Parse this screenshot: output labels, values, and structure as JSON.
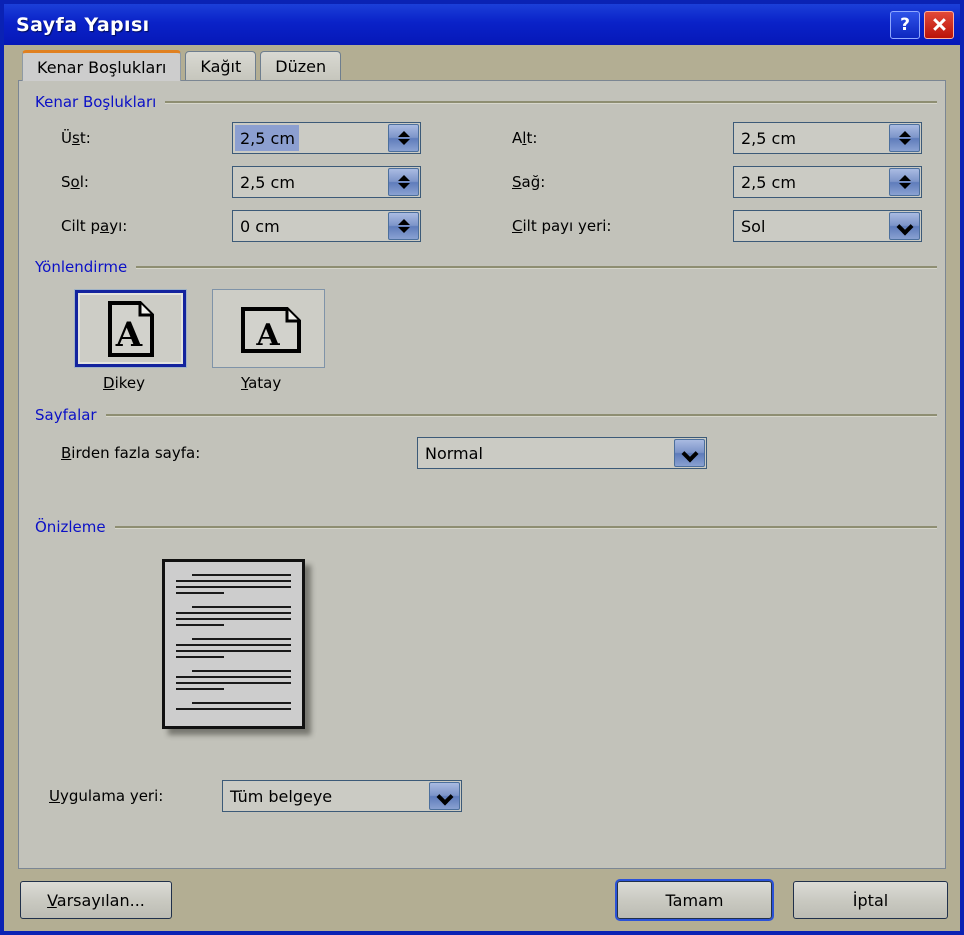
{
  "window": {
    "title": "Sayfa Yapısı",
    "help_button": "?",
    "close_button": "×"
  },
  "tabs": [
    {
      "label": "Kenar Boşlukları",
      "active": true
    },
    {
      "label": "Kağıt",
      "active": false
    },
    {
      "label": "Düzen",
      "active": false
    }
  ],
  "margins_group": {
    "title": "Kenar Boşlukları",
    "fields": {
      "top": {
        "label": "Üst:",
        "accel": "s",
        "value": "2,5 cm",
        "selected": true
      },
      "left": {
        "label": "Sol:",
        "accel": "o",
        "value": "2,5 cm",
        "selected": false
      },
      "gutter": {
        "label": "Cilt payı:",
        "accel": "a",
        "value": "0 cm",
        "selected": false
      },
      "bottom": {
        "label": "Alt:",
        "accel": "l",
        "value": "2,5 cm",
        "selected": false
      },
      "right": {
        "label": "Sağ:",
        "accel": "S",
        "value": "2,5 cm",
        "selected": false
      },
      "gutter_position": {
        "label": "Cilt payı yeri:",
        "accel": "C",
        "value": "Sol"
      }
    }
  },
  "orientation_group": {
    "title": "Yönlendirme",
    "options": [
      {
        "label": "Dikey",
        "accel": "D",
        "selected": true,
        "icon": "page-portrait-icon"
      },
      {
        "label": "Yatay",
        "accel": "Y",
        "selected": false,
        "icon": "page-landscape-icon"
      }
    ]
  },
  "pages_group": {
    "title": "Sayfalar",
    "multiple_pages": {
      "label": "Birden fazla sayfa:",
      "accel": "B",
      "value": "Normal"
    }
  },
  "preview_group": {
    "title": "Önizleme",
    "apply_to": {
      "label": "Uygulama yeri:",
      "accel": "U",
      "value": "Tüm belgeye"
    }
  },
  "footer": {
    "default_button": "Varsayılan...",
    "ok_button": "Tamam",
    "cancel_button": "İptal"
  },
  "colors": {
    "titlebar": "#0a22c8",
    "dialog_background": "#b3ae93",
    "panel_background": "#c2c2ba",
    "group_title": "#0b10c6",
    "selection": "#8c9fd0",
    "accent_tab": "#e08020",
    "close_button": "#bb1208"
  }
}
